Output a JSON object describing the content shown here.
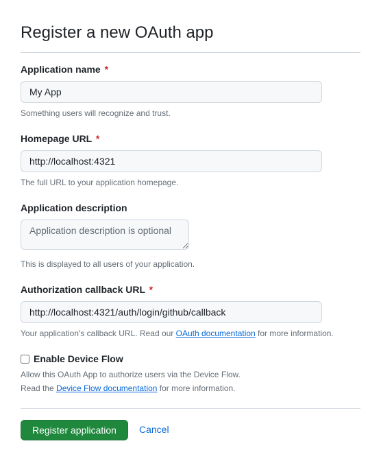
{
  "page_title": "Register a new OAuth app",
  "fields": {
    "app_name": {
      "label": "Application name",
      "value": "My App",
      "hint": "Something users will recognize and trust."
    },
    "homepage_url": {
      "label": "Homepage URL",
      "value": "http://localhost:4321",
      "hint": "The full URL to your application homepage."
    },
    "description": {
      "label": "Application description",
      "placeholder": "Application description is optional",
      "hint": "This is displayed to all users of your application."
    },
    "callback_url": {
      "label": "Authorization callback URL",
      "value": "http://localhost:4321/auth/login/github/callback",
      "hint_prefix": "Your application's callback URL. Read our ",
      "hint_link": "OAuth documentation",
      "hint_suffix": " for more information."
    },
    "device_flow": {
      "label": "Enable Device Flow",
      "desc_line1": "Allow this OAuth App to authorize users via the Device Flow.",
      "desc_prefix": "Read the ",
      "desc_link": "Device Flow documentation",
      "desc_suffix": " for more information."
    }
  },
  "required_mark": "*",
  "actions": {
    "submit": "Register application",
    "cancel": "Cancel"
  }
}
